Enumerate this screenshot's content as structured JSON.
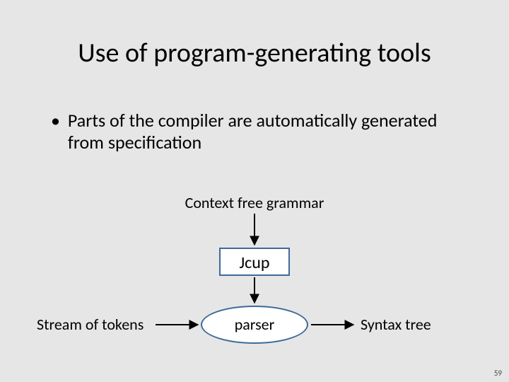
{
  "title": "Use of program-generating tools",
  "bullet": "Parts of the compiler are automatically generated from specification",
  "labels": {
    "grammar": "Context free grammar",
    "tool": "Jcup",
    "input": "Stream of tokens",
    "process": "parser",
    "output": "Syntax tree"
  },
  "page_number": "59"
}
